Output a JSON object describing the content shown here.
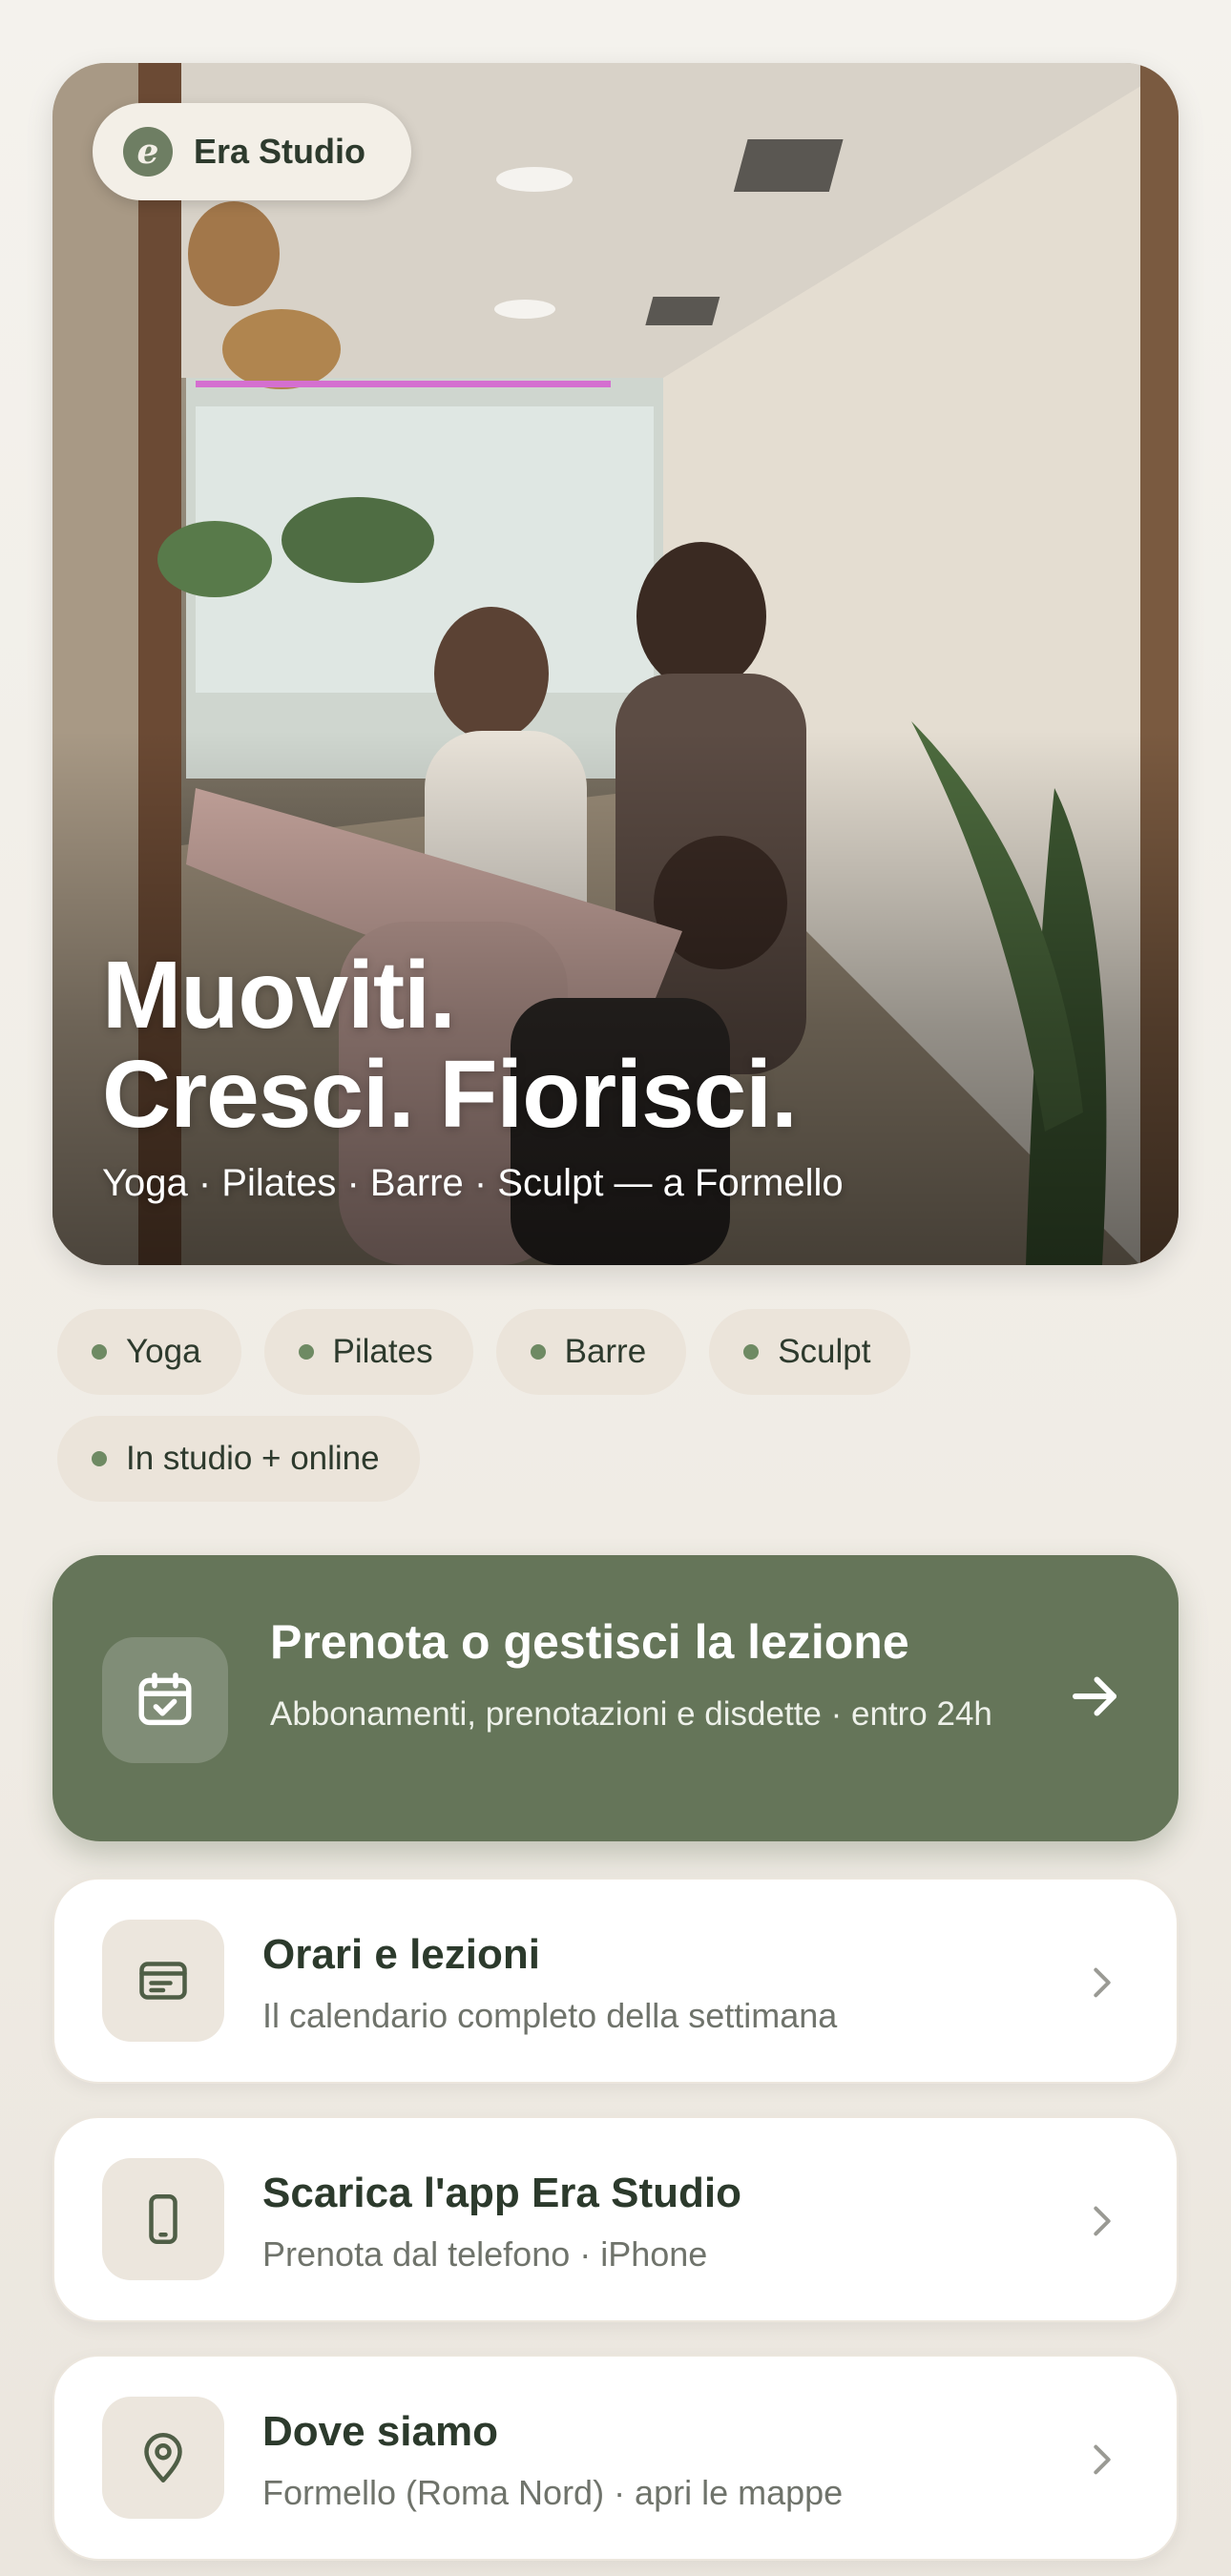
{
  "brand": {
    "name": "Era Studio",
    "logo_letter": "e"
  },
  "hero": {
    "title_line1": "Muoviti.",
    "title_line2": "Cresci. Fiorisci.",
    "subtitle": "Yoga · Pilates · Barre · Sculpt — a Formello"
  },
  "tags": [
    "Yoga",
    "Pilates",
    "Barre",
    "Sculpt",
    "In studio + online"
  ],
  "primary_action": {
    "title": "Prenota o gestisci la lezione",
    "subtitle": "Abbonamenti, prenotazioni e disdette · entro 24h",
    "icon": "calendar-check-icon"
  },
  "cards": [
    {
      "title": "Orari e lezioni",
      "subtitle": "Il calendario completo della settimana",
      "icon": "schedule-icon"
    },
    {
      "title": "Scarica l'app Era Studio",
      "subtitle": "Prenota dal telefono · iPhone",
      "icon": "phone-icon"
    },
    {
      "title": "Dove siamo",
      "subtitle": "Formello (Roma Nord) · apri le mappe",
      "icon": "map-pin-icon"
    }
  ],
  "colors": {
    "background": "#f2efe9",
    "accent_green": "#657559",
    "tag_bg": "#ebe4da",
    "icon_tile": "#ece6dd",
    "text_dark": "#2c3a2c",
    "text_muted": "#6f736b"
  }
}
